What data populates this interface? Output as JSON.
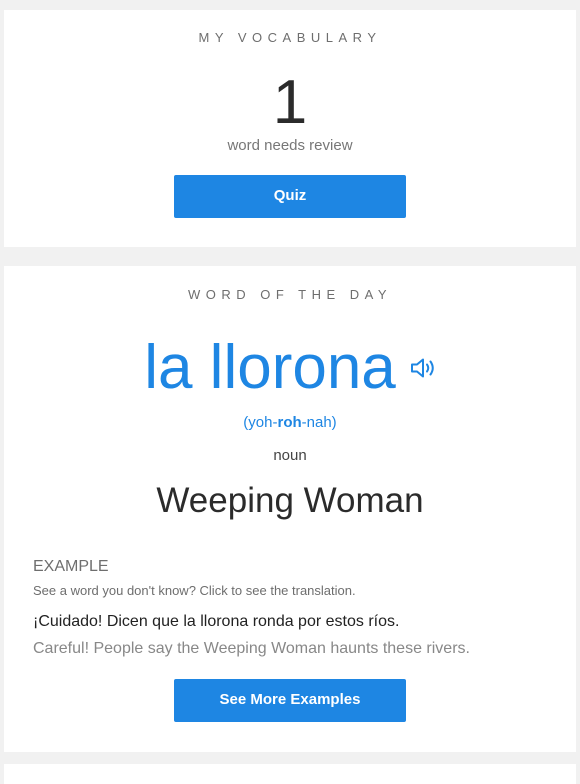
{
  "vocabulary": {
    "title": "MY VOCABULARY",
    "count": "1",
    "count_label": "word needs review",
    "quiz_label": "Quiz"
  },
  "word_of_day": {
    "title": "WORD OF THE DAY",
    "word": "la llorona",
    "pronunciation": {
      "open": "(yoh-",
      "stress": "roh",
      "close": "-nah)"
    },
    "part_of_speech": "noun",
    "translation": "Weeping Woman",
    "example_heading": "EXAMPLE",
    "example_hint": "See a word you don't know? Click to see the translation.",
    "example_sentence": "¡Cuidado! Dicen que la llorona ronda por estos ríos.",
    "example_translation": "Careful! People say the Weeping Woman haunts these rivers.",
    "more_examples_label": "See More Examples"
  },
  "colors": {
    "accent": "#1e86e3",
    "background": "#f1f1f1",
    "card": "#ffffff"
  },
  "icons": {
    "audio": "speaker-icon"
  }
}
